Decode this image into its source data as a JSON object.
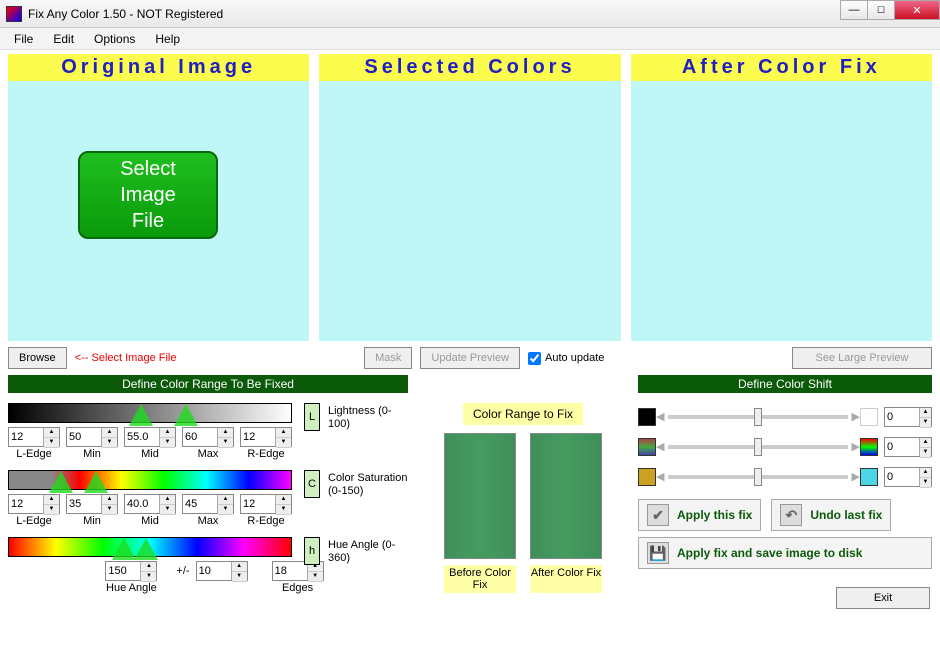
{
  "window": {
    "title": "Fix Any Color 1.50 - NOT Registered"
  },
  "menu": {
    "items": [
      "File",
      "Edit",
      "Options",
      "Help"
    ]
  },
  "panels": {
    "original": "Original Image",
    "selected": "Selected Colors",
    "after": "After Color Fix",
    "select_image_btn": "Select\nImage\nFile"
  },
  "row2": {
    "browse": "Browse",
    "hint": "<-- Select Image File",
    "mask": "Mask",
    "update_preview": "Update Preview",
    "auto_update": "Auto update",
    "see_large": "See Large Preview"
  },
  "range_section": {
    "title": "Define Color Range To Be Fixed",
    "lightness": {
      "chip": "L",
      "label": "Lightness (0-100)",
      "ledge": "12",
      "min": "50",
      "mid": "55.0",
      "max": "60",
      "redge": "12",
      "labels": {
        "ledge": "L-Edge",
        "min": "Min",
        "mid": "Mid",
        "max": "Max",
        "redge": "R-Edge"
      }
    },
    "saturation": {
      "chip": "C",
      "label": "Color Saturation (0-150)",
      "ledge": "12",
      "min": "35",
      "mid": "40.0",
      "max": "45",
      "redge": "12"
    },
    "hue": {
      "chip": "h",
      "label": "Hue Angle (0-360)",
      "angle": "150",
      "pm": "10",
      "edges": "18",
      "labels": {
        "angle": "Hue Angle",
        "pm": "+/-",
        "edges": "Edges"
      }
    }
  },
  "mid": {
    "title": "Color Range to Fix",
    "before": "Before Color Fix",
    "after": "After Color Fix"
  },
  "shift_section": {
    "title": "Define Color Shift",
    "val1": "0",
    "val2": "0",
    "val3": "0",
    "apply": "Apply this fix",
    "undo": "Undo last fix",
    "save": "Apply fix and save image to disk",
    "exit": "Exit"
  }
}
